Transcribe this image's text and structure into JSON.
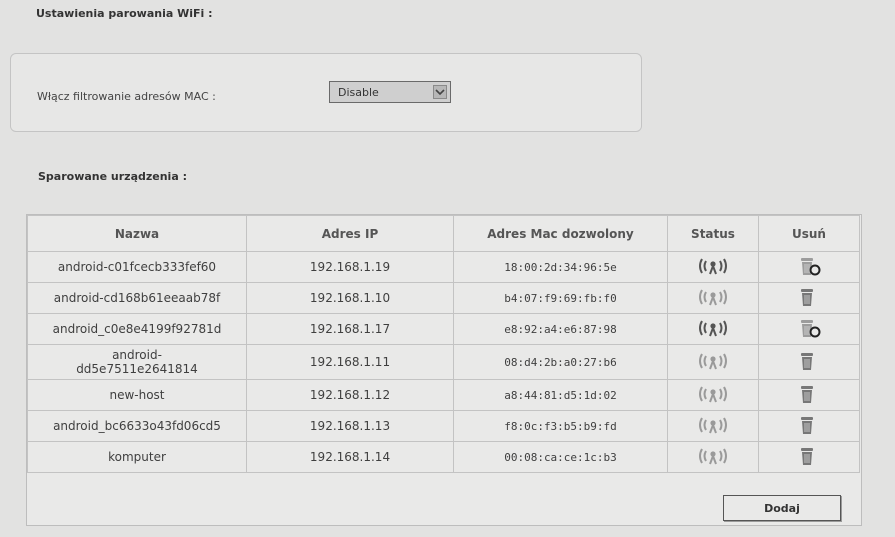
{
  "page": {
    "title_wifi": "Ustawienia parowania WiFi :",
    "title_devices": "Sparowane urządzenia :"
  },
  "mac_filter": {
    "label": "Włącz filtrowanie adresów MAC :",
    "value": "Disable"
  },
  "table": {
    "headers": [
      "Nazwa",
      "Adres IP",
      "Adres Mac dozwolony",
      "Status",
      "Usuń"
    ],
    "rows": [
      {
        "name": "android-c01fcecb333fef60",
        "ip": "192.168.1.19",
        "mac": "18:00:2d:34:96:5e",
        "status": "active",
        "delete": "blocked"
      },
      {
        "name": "android-cd168b61eeaab78f",
        "ip": "192.168.1.10",
        "mac": "b4:07:f9:69:fb:f0",
        "status": "inactive",
        "delete": "available"
      },
      {
        "name": "android_c0e8e4199f92781d",
        "ip": "192.168.1.17",
        "mac": "e8:92:a4:e6:87:98",
        "status": "active",
        "delete": "blocked"
      },
      {
        "name": "android-dd5e7511e2641814",
        "ip": "192.168.1.11",
        "mac": "08:d4:2b:a0:27:b6",
        "status": "inactive",
        "delete": "available"
      },
      {
        "name": "new-host",
        "ip": "192.168.1.12",
        "mac": "a8:44:81:d5:1d:02",
        "status": "inactive",
        "delete": "available"
      },
      {
        "name": "android_bc6633o43fd06cd5",
        "ip": "192.168.1.13",
        "mac": "f8:0c:f3:b5:b9:fd",
        "status": "inactive",
        "delete": "available"
      },
      {
        "name": "komputer",
        "ip": "192.168.1.14",
        "mac": "00:08:ca:ce:1c:b3",
        "status": "inactive",
        "delete": "available"
      }
    ]
  },
  "actions": {
    "add_label": "Dodaj"
  },
  "icons": {
    "status": "wireless-signal-icon",
    "delete": "trash-icon",
    "select_arrow": "chevron-down-icon"
  }
}
